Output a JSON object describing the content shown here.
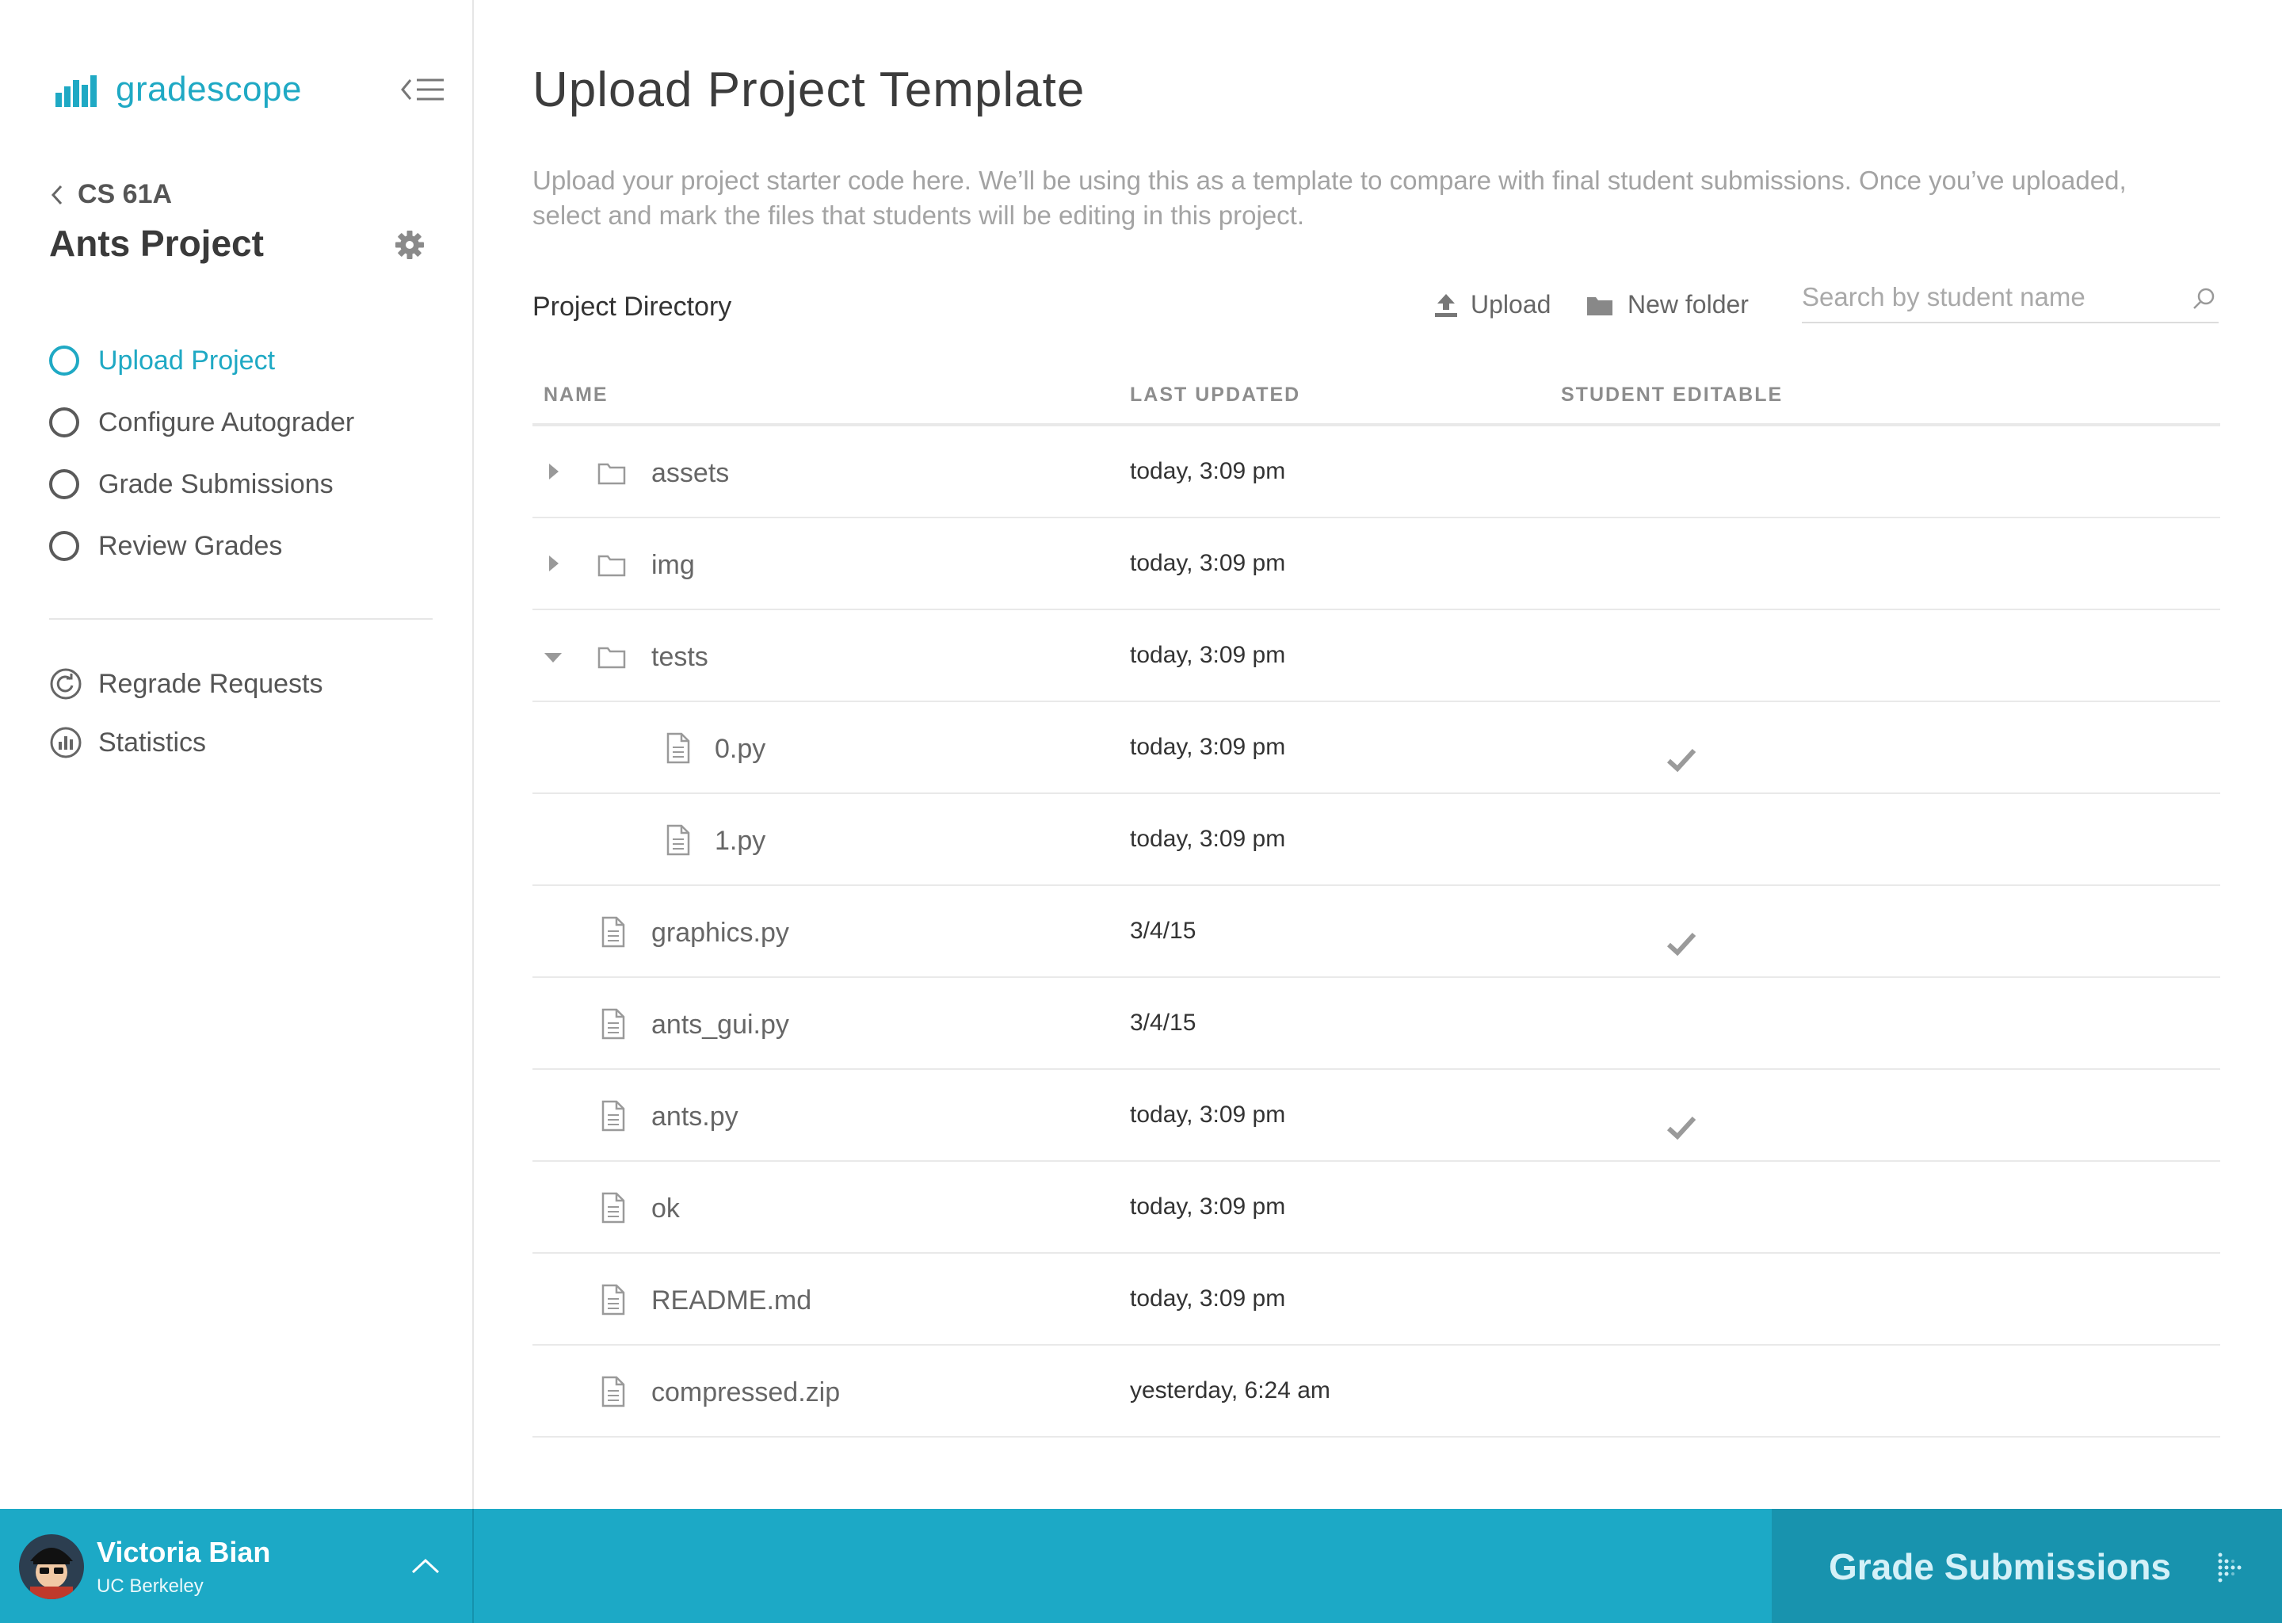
{
  "brand": {
    "name": "gradescope",
    "accent": "#1fa9c4"
  },
  "sidebar": {
    "back_label": "CS 61A",
    "course_title": "Ants Project",
    "steps": [
      {
        "label": "Upload Project",
        "active": true
      },
      {
        "label": "Configure Autograder",
        "active": false
      },
      {
        "label": "Grade Submissions",
        "active": false
      },
      {
        "label": "Review Grades",
        "active": false
      }
    ],
    "extras": [
      {
        "label": "Regrade Requests",
        "icon": "regrade-icon"
      },
      {
        "label": "Statistics",
        "icon": "statistics-icon"
      }
    ]
  },
  "main": {
    "title": "Upload Project Template",
    "description": "Upload your project starter code here. We’ll be using this as a template to compare with final student submissions. Once you’ve uploaded, select and mark the files that students will be editing in this project.",
    "directory_label": "Project Directory",
    "upload_label": "Upload",
    "new_folder_label": "New folder",
    "search_placeholder": "Search by student name",
    "columns": {
      "name": "NAME",
      "updated": "LAST UPDATED",
      "editable": "STUDENT EDITABLE"
    },
    "files": [
      {
        "name": "assets",
        "type": "folder",
        "expanded": false,
        "depth": 0,
        "updated": "today, 3:09 pm",
        "editable": false
      },
      {
        "name": "img",
        "type": "folder",
        "expanded": false,
        "depth": 0,
        "updated": "today, 3:09 pm",
        "editable": false
      },
      {
        "name": "tests",
        "type": "folder",
        "expanded": true,
        "depth": 0,
        "updated": "today, 3:09 pm",
        "editable": false
      },
      {
        "name": "0.py",
        "type": "file",
        "depth": 1,
        "updated": "today, 3:09 pm",
        "editable": true
      },
      {
        "name": "1.py",
        "type": "file",
        "depth": 1,
        "updated": "today, 3:09 pm",
        "editable": false
      },
      {
        "name": "graphics.py",
        "type": "file",
        "depth": 0,
        "updated": "3/4/15",
        "editable": true
      },
      {
        "name": "ants_gui.py",
        "type": "file",
        "depth": 0,
        "updated": "3/4/15",
        "editable": false
      },
      {
        "name": "ants.py",
        "type": "file",
        "depth": 0,
        "updated": "today, 3:09 pm",
        "editable": true
      },
      {
        "name": "ok",
        "type": "file",
        "depth": 0,
        "updated": "today, 3:09 pm",
        "editable": false
      },
      {
        "name": "README.md",
        "type": "file",
        "depth": 0,
        "updated": "today, 3:09 pm",
        "editable": false
      },
      {
        "name": "compressed.zip",
        "type": "file",
        "depth": 0,
        "updated": "yesterday, 6:24 am",
        "editable": false
      }
    ]
  },
  "footer": {
    "user_name": "Victoria Bian",
    "user_org": "UC Berkeley",
    "action_label": "Grade Submissions",
    "bar_color": "#1ca9c6"
  }
}
